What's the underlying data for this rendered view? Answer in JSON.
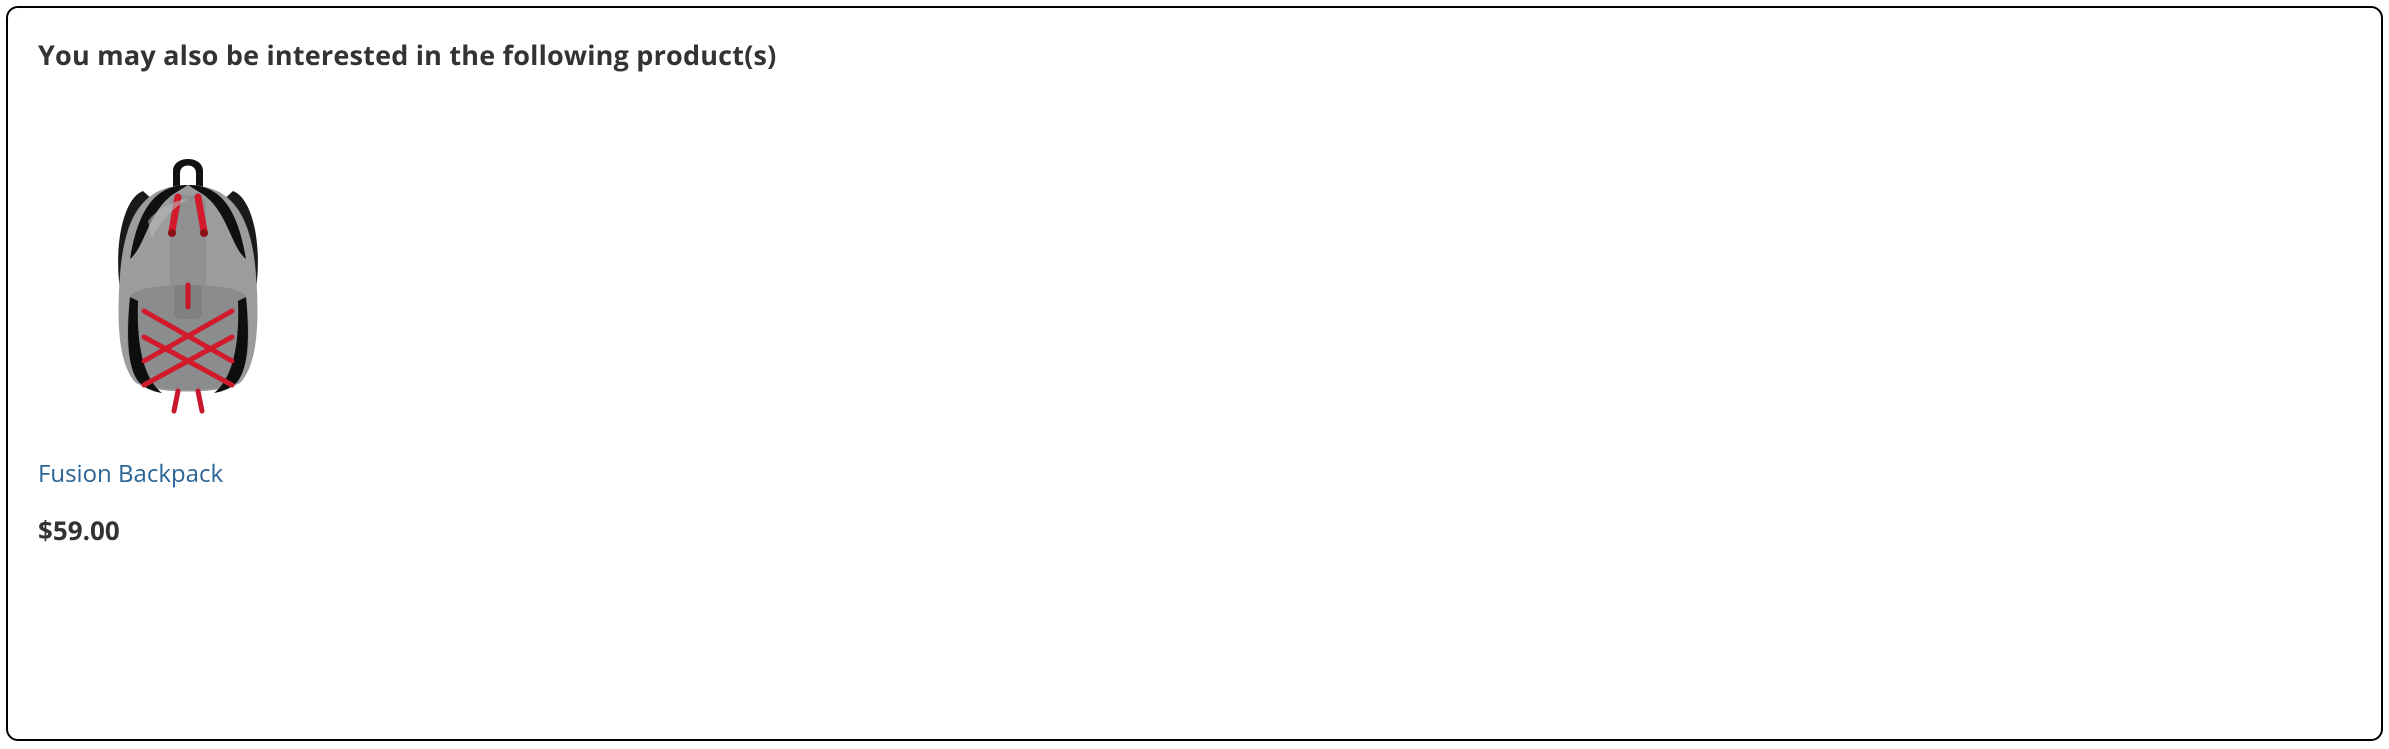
{
  "upsell": {
    "title": "You may also be interested in the following product(s)",
    "products": [
      {
        "name": "Fusion Backpack",
        "price": "$59.00"
      }
    ]
  }
}
